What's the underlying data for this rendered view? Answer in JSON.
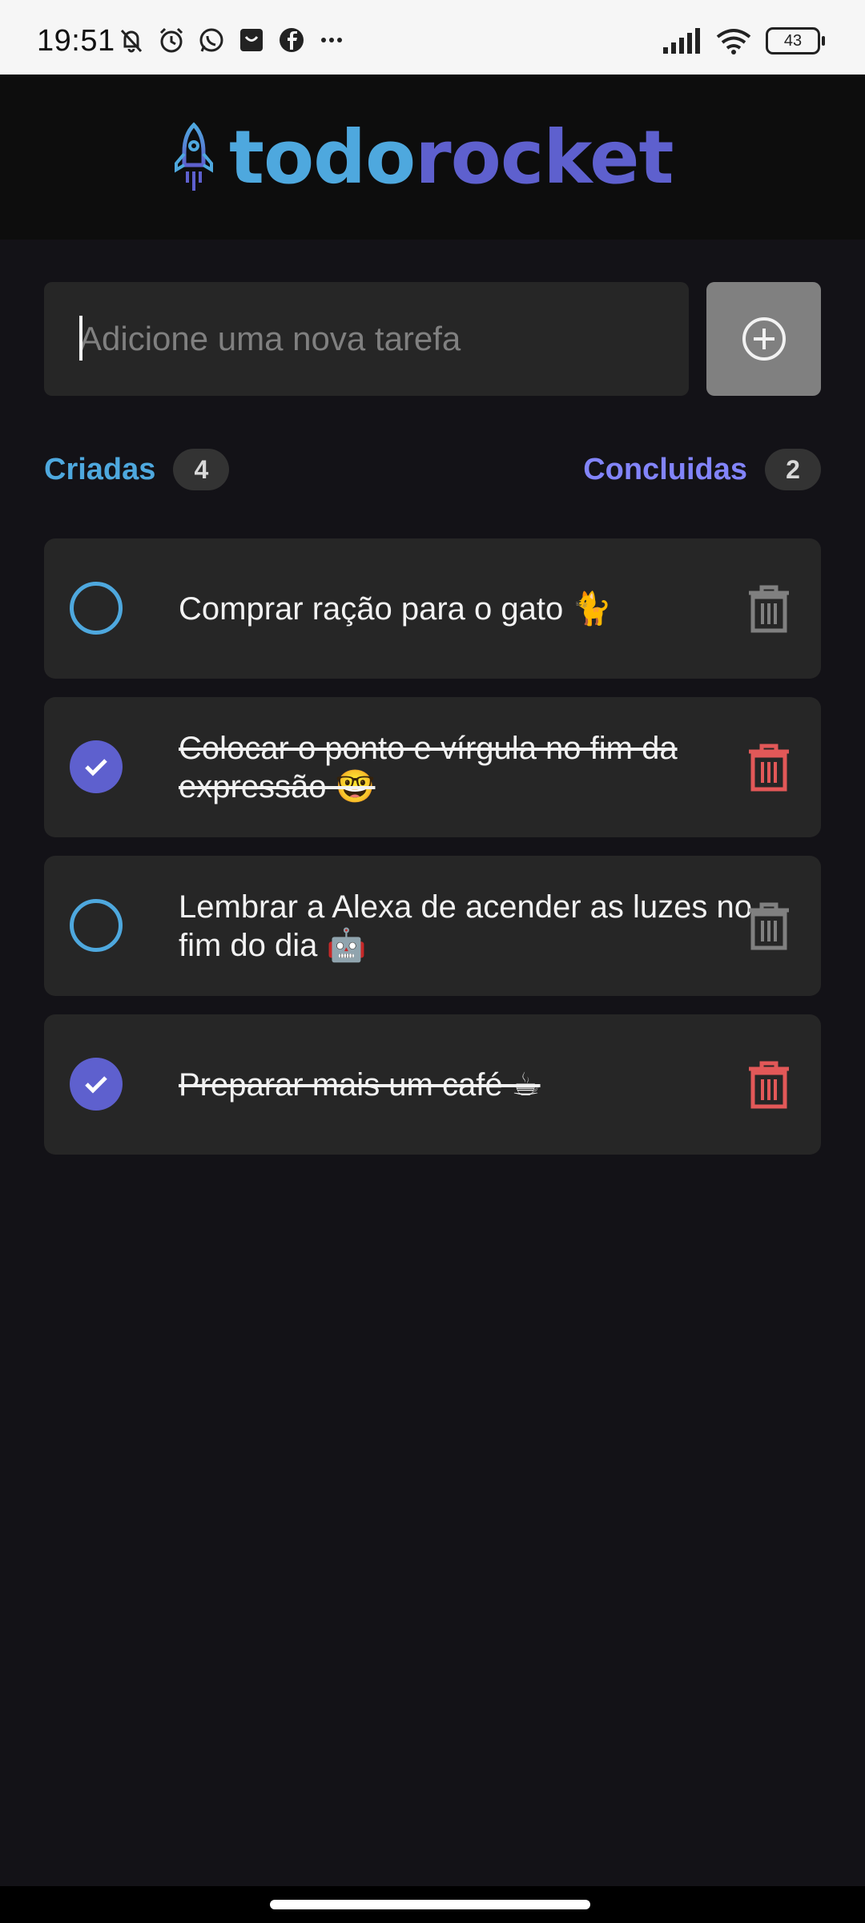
{
  "status_bar": {
    "time": "19:51",
    "battery": "43",
    "left_icons": [
      "bell-off-icon",
      "alarm-icon",
      "whatsapp-icon",
      "shop-icon",
      "facebook-icon",
      "more-dots-icon"
    ],
    "right_icons": [
      "signal-icon",
      "wifi-icon",
      "battery-icon"
    ]
  },
  "header": {
    "logo_part1": "todo",
    "logo_part2": "rocket",
    "logo_icon": "rocket-icon"
  },
  "new_task": {
    "placeholder": "Adicione uma nova tarefa",
    "value": "",
    "add_icon": "plus-circle-icon"
  },
  "counters": {
    "created_label": "Criadas",
    "created_count": "4",
    "done_label": "Concluidas",
    "done_count": "2"
  },
  "tasks": [
    {
      "text": "Comprar ração para o gato 🐈",
      "done": false
    },
    {
      "text": "Colocar o ponto e vírgula no fim da expressão 🤓",
      "done": true
    },
    {
      "text": "Lembrar a Alexa de acender as luzes no fim do dia 🤖",
      "done": false
    },
    {
      "text": "Preparar mais um café ☕",
      "done": true
    }
  ],
  "colors": {
    "background": "#131217",
    "header_bg": "#0d0d0d",
    "card_bg": "#262626",
    "blue": "#4ea8de",
    "purple": "#5e60ce",
    "purple_light": "#8284fa",
    "trash_idle": "#808080",
    "trash_done": "#e25858"
  }
}
